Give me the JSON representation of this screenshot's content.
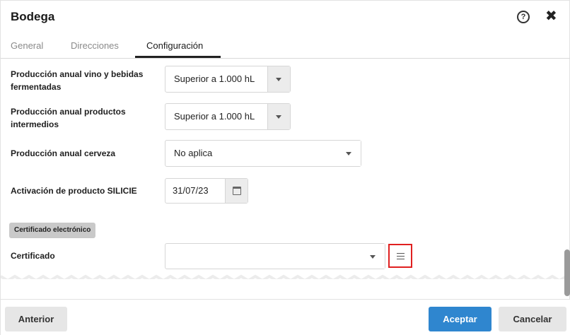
{
  "dialog": {
    "title": "Bodega",
    "help_glyph": "?",
    "close_glyph": "✖"
  },
  "tabs": [
    {
      "label": "General",
      "active": false
    },
    {
      "label": "Direcciones",
      "active": false
    },
    {
      "label": "Configuración",
      "active": true
    }
  ],
  "fields": {
    "vino": {
      "label": "Producción anual vino y bebidas fermentadas",
      "value": "Superior a 1.000 hL"
    },
    "intermedios": {
      "label": "Producción anual productos intermedios",
      "value": "Superior a 1.000 hL"
    },
    "cerveza": {
      "label": "Producción anual cerveza",
      "value": "No aplica"
    },
    "silicie": {
      "label": "Activación de producto SILICIE",
      "value": "31/07/23"
    },
    "certificado": {
      "label": "Certificado",
      "value": ""
    }
  },
  "section": {
    "label": "Certificado electrónico"
  },
  "footer": {
    "prev_label": "Anterior",
    "accept_label": "Aceptar",
    "cancel_label": "Cancelar"
  },
  "colors": {
    "accent": "#2f86cf",
    "highlight": "#e02020"
  }
}
